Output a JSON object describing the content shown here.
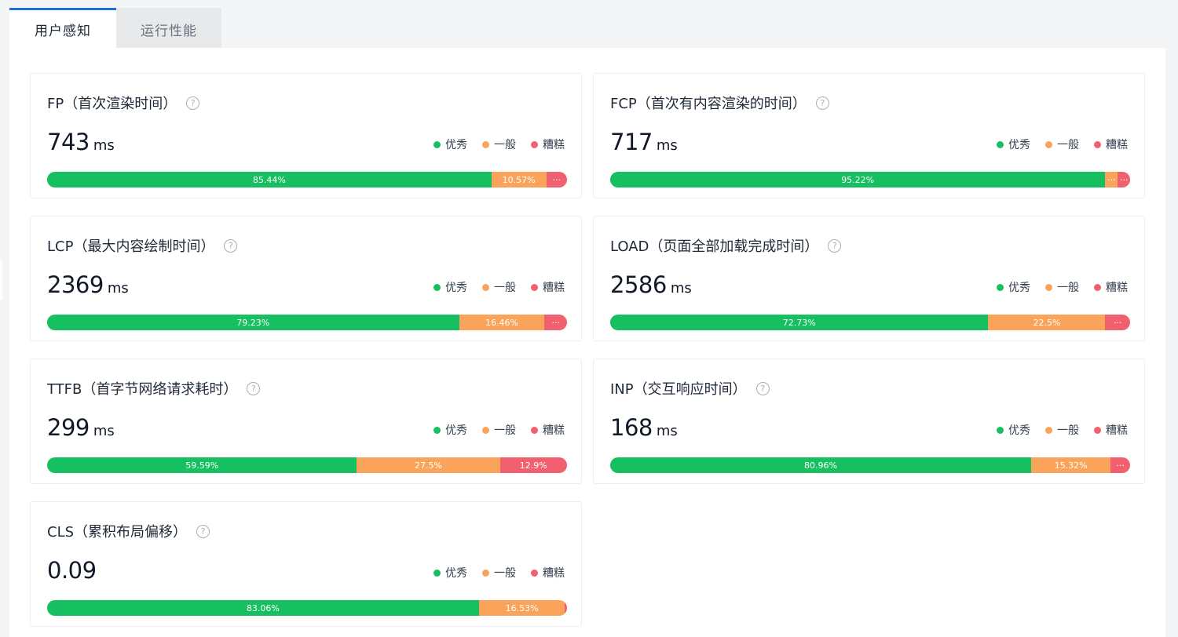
{
  "tabs": [
    {
      "label": "用户感知",
      "active": true
    },
    {
      "label": "运行性能",
      "active": false
    }
  ],
  "legend": {
    "good": "优秀",
    "mid": "一般",
    "bad": "糟糕"
  },
  "colors": {
    "good": "#16c060",
    "mid": "#f9a45a",
    "bad": "#f1606f",
    "accent": "#1e6fd9"
  },
  "help_icon": "question-circle-icon",
  "cards": [
    {
      "title": "FP（首次渲染时间）",
      "value": "743",
      "unit": "ms",
      "good": 85.44,
      "mid": 10.57,
      "bad": 3.99,
      "good_label": "85.44%",
      "mid_label": "10.57%",
      "bad_label": "···"
    },
    {
      "title": "FCP（首次有内容渲染的时间）",
      "value": "717",
      "unit": "ms",
      "good": 95.22,
      "mid": 2.4,
      "bad": 2.38,
      "good_label": "95.22%",
      "mid_label": "···",
      "bad_label": "···"
    },
    {
      "title": "LCP（最大内容绘制时间）",
      "value": "2369",
      "unit": "ms",
      "good": 79.23,
      "mid": 16.46,
      "bad": 4.31,
      "good_label": "79.23%",
      "mid_label": "16.46%",
      "bad_label": "···"
    },
    {
      "title": "LOAD（页面全部加载完成时间）",
      "value": "2586",
      "unit": "ms",
      "good": 72.73,
      "mid": 22.5,
      "bad": 4.77,
      "good_label": "72.73%",
      "mid_label": "22.5%",
      "bad_label": "···"
    },
    {
      "title": "TTFB（首字节网络请求耗时）",
      "value": "299",
      "unit": "ms",
      "good": 59.59,
      "mid": 27.5,
      "bad": 12.9,
      "good_label": "59.59%",
      "mid_label": "27.5%",
      "bad_label": "12.9%"
    },
    {
      "title": "INP（交互响应时间）",
      "value": "168",
      "unit": "ms",
      "good": 80.96,
      "mid": 15.32,
      "bad": 3.72,
      "good_label": "80.96%",
      "mid_label": "15.32%",
      "bad_label": "···"
    },
    {
      "title": "CLS（累积布局偏移）",
      "value": "0.09",
      "unit": "",
      "good": 83.06,
      "mid": 16.53,
      "bad": 0.41,
      "good_label": "83.06%",
      "mid_label": "16.53%",
      "bad_label": ""
    }
  ]
}
